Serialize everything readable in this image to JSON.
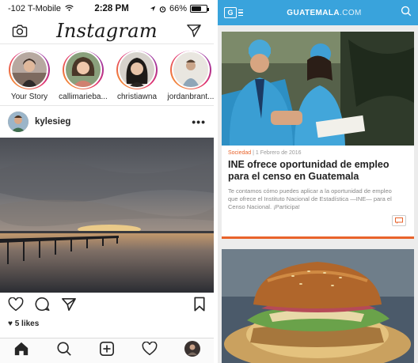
{
  "instagram": {
    "status": {
      "carrier": "-102 T-Mobile",
      "time": "2:28 PM",
      "battery": "66%",
      "battery_level": 0.66
    },
    "logo": "Instagram",
    "stories": [
      {
        "name": "Your Story"
      },
      {
        "name": "callimarieba..."
      },
      {
        "name": "christiawna"
      },
      {
        "name": "jordanbrant..."
      }
    ],
    "post": {
      "username": "kylesieg",
      "more": "•••",
      "likes": "5 likes"
    },
    "icons": {
      "camera": "camera-icon",
      "direct": "paper-plane-icon",
      "like": "heart-icon",
      "comment": "comment-icon",
      "share": "paper-plane-icon",
      "save": "bookmark-icon",
      "home": "home-icon",
      "search": "search-icon",
      "add": "plus-square-icon",
      "activity": "heart-icon",
      "profile": "avatar"
    }
  },
  "guatemala": {
    "header": {
      "logo": "G",
      "site_name": "GUATEMALA",
      "site_suffix": ".COM"
    },
    "article": {
      "category": "Sociedad",
      "date": "1 Febrero de 2016",
      "title": "INE ofrece oportunidad de empleo para el censo en Guatemala",
      "excerpt": "Te contamos cómo puedes aplicar a la oportunidad de empleo que ofrece el Instituto Nacional de Estadística —INE— para el Censo Nacional. ¡Participa!"
    },
    "colors": {
      "header": "#39a3dc",
      "accent": "#e8632b"
    }
  }
}
